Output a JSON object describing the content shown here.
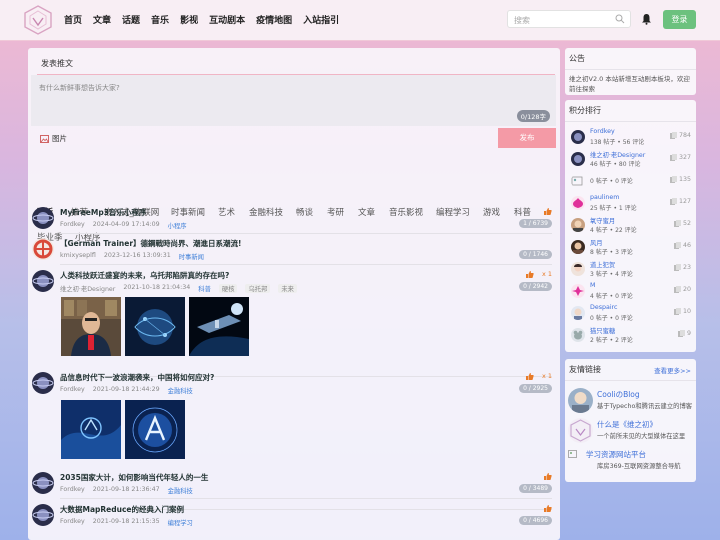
{
  "nav": {
    "items": [
      "首页",
      "文章",
      "话题",
      "音乐",
      "影视",
      "互动剧本",
      "疫情地图",
      "入站指引"
    ],
    "search_placeholder": "搜索",
    "login_label": "登录"
  },
  "composer": {
    "tab_label": "发表推文",
    "placeholder": "有什么新鲜事想告诉大家?",
    "counter": "0/128字",
    "image_label": "图片",
    "publish_label": "发布"
  },
  "tabs": [
    "最新",
    "推荐",
    "嵌入式_物联网",
    "时事新闻",
    "艺术",
    "金融科技",
    "畅谈",
    "考研",
    "文章",
    "音乐影视",
    "编程学习",
    "游戏",
    "科普",
    "毕业季",
    "小程序"
  ],
  "feed": [
    {
      "title": "MyFreeMp3音乐小程序",
      "author": "Fordkey",
      "date": "2024-04-09 17:14:09",
      "category": "小程序",
      "stats": "1 / 6739",
      "likes": ""
    },
    {
      "title": "【German Trainer】德鋼戰時尚界、潮進日系潮流!",
      "author": "kmixyseplfl",
      "date": "2023-12-16 13:09:31",
      "category": "时事新闻",
      "stats": "0 / 1746",
      "likes": ""
    },
    {
      "title": "人类科技跃迁盛宴的未来，乌托邦陷阱真的存在吗?",
      "author": "维之初·老Designer",
      "date": "2021-10-18 21:04:34",
      "category": "科普",
      "tags": [
        "硬核",
        "乌托邦",
        "未来"
      ],
      "stats": "0 / 2942",
      "likes": "x 1"
    },
    {
      "title": "品信息时代下一波浪潮袭来，中国将如何应对?",
      "author": "Fordkey",
      "date": "2021-09-18 21:44:29",
      "category": "金融科技",
      "stats": "0 / 2925",
      "likes": "x 1"
    },
    {
      "title": "2035国家大计，如何影响当代年轻人的一生",
      "author": "Fordkey",
      "date": "2021-09-18 21:36:47",
      "category": "金融科技",
      "stats": "0 / 3489",
      "likes": ""
    },
    {
      "title": "大数据MapReduce的经典入门案例",
      "author": "Fordkey",
      "date": "2021-09-18 21:15:35",
      "category": "编程学习",
      "stats": "0 / 4696",
      "likes": ""
    }
  ],
  "notice": {
    "title": "公告",
    "text": "维之初V2.0 本站新增互动剧本板块，欢迎前往探索"
  },
  "ranking": {
    "title": "积分排行",
    "rows": [
      {
        "name": "Fordkey",
        "stats": "138 帖子 • 56 评论",
        "points": "784"
      },
      {
        "name": "维之初·老Designer",
        "stats": "46 帖子 • 80 评论",
        "points": "327"
      },
      {
        "name": "",
        "stats": "0 帖子 • 0 评论",
        "points": "135"
      },
      {
        "name": "paulinem",
        "stats": "25 帖子 • 1 评论",
        "points": "127"
      },
      {
        "name": "氧守蜜月",
        "stats": "4 帖子 • 22 评论",
        "points": "52"
      },
      {
        "name": "风月",
        "stats": "8 帖子 • 3 评论",
        "points": "46"
      },
      {
        "name": "道上犯贺",
        "stats": "3 帖子 • 4 评论",
        "points": "23"
      },
      {
        "name": "M",
        "stats": "4 帖子 • 0 评论",
        "points": "20"
      },
      {
        "name": "Despairc",
        "stats": "0 帖子 • 0 评论",
        "points": "10"
      },
      {
        "name": "猫只蜜糖",
        "stats": "2 帖子 • 2 评论",
        "points": "9"
      }
    ]
  },
  "links": {
    "title": "友情链接",
    "more": "查看更多>>",
    "rows": [
      {
        "name": "CooliのBlog",
        "desc": "基于Typecho和腾讯云建立的博客"
      },
      {
        "name": "什么是《维之初》",
        "desc": "一个前所未见的大型媒体在这里"
      },
      {
        "name": "学习资源网站平台",
        "desc": "库房369-互联网资源整合导航"
      }
    ]
  }
}
